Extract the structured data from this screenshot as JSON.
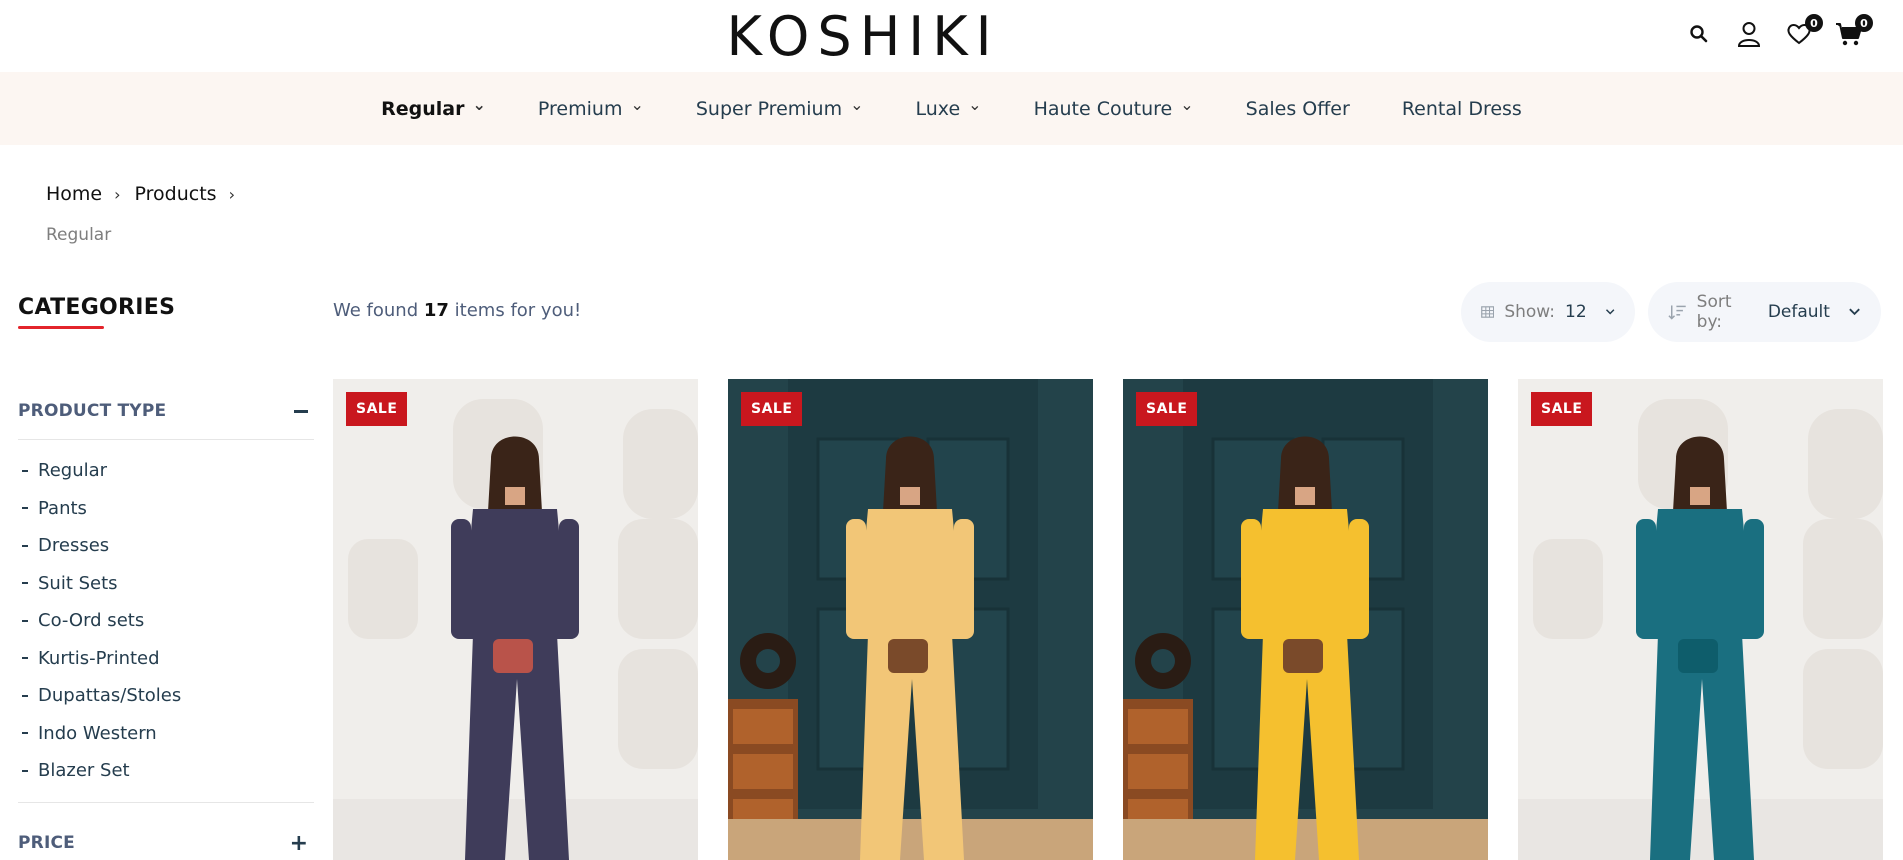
{
  "brand": {
    "logo_text": "KOSHIKI"
  },
  "header": {
    "icons": [
      "search-icon",
      "user-icon",
      "heart-icon",
      "cart-icon"
    ],
    "wishlist_count": "0",
    "cart_count": "0"
  },
  "nav": {
    "items": [
      {
        "label": "Regular",
        "has_dropdown": true,
        "active": true
      },
      {
        "label": "Premium",
        "has_dropdown": true
      },
      {
        "label": "Super Premium",
        "has_dropdown": true
      },
      {
        "label": "Luxe",
        "has_dropdown": true
      },
      {
        "label": "Haute Couture",
        "has_dropdown": true
      },
      {
        "label": "Sales Offer",
        "has_dropdown": false
      },
      {
        "label": "Rental Dress",
        "has_dropdown": false
      }
    ]
  },
  "breadcrumb": {
    "home": "Home",
    "products": "Products",
    "current": "Regular"
  },
  "sidebar": {
    "categories_title": "CATEGORIES",
    "product_type_title": "PRODUCT TYPE",
    "product_types": [
      "Regular",
      "Pants",
      "Dresses",
      "Suit Sets",
      "Co-Ord sets",
      "Kurtis-Printed",
      "Dupattas/Stoles",
      "Indo Western",
      "Blazer Set"
    ],
    "price_title": "PRICE"
  },
  "results": {
    "prefix": "We found",
    "count": "17",
    "suffix": "items for you!",
    "show_label": "Show:",
    "show_value": "12",
    "sort_label": "Sort by:",
    "sort_value": "Default"
  },
  "products": [
    {
      "badge": "SALE",
      "bg": "#f0eeeb",
      "outfit": "#3f3c5a",
      "accent": "#b9534a"
    },
    {
      "badge": "SALE",
      "bg": "#23434a",
      "outfit": "#f2c677",
      "accent": "#7a4a2a"
    },
    {
      "badge": "SALE",
      "bg": "#23434a",
      "outfit": "#f5c02f",
      "accent": "#7a4a2a"
    },
    {
      "badge": "SALE",
      "bg": "#f0eeeb",
      "outfit": "#1a6f80",
      "accent": "#0e5d6b"
    }
  ],
  "colors": {
    "accent_red": "#c9171e",
    "nav_bg": "#fcf6f2",
    "text": "#253d4e"
  }
}
